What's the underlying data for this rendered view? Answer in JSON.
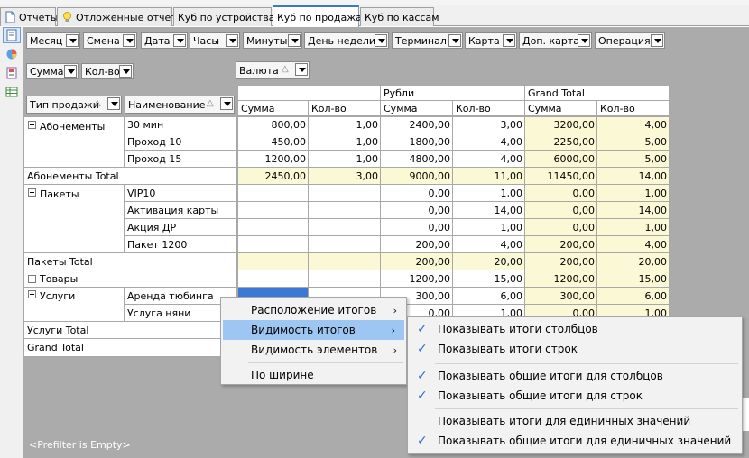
{
  "tabs": [
    {
      "label": "Отчеты",
      "icon": "document-icon"
    },
    {
      "label": "Отложенные отчеты",
      "icon": "lightbulb-icon"
    },
    {
      "label": "Куб по устройствам",
      "icon": ""
    },
    {
      "label": "Куб по продажам",
      "icon": "",
      "active": true
    },
    {
      "label": "Куб по кассам",
      "icon": ""
    }
  ],
  "sidebar": [
    "grid-view-icon",
    "chart-icon",
    "report-icon",
    "table-icon"
  ],
  "filter_fields": [
    "Месяц",
    "Смена",
    "Дата",
    "Часы",
    "Минуты",
    "День недели",
    "Терминал",
    "Карта",
    "Доп. карта",
    "Операция"
  ],
  "data_fields": [
    "Сумма",
    "Кол-во"
  ],
  "column_field": "Валюта",
  "row_fields": [
    "Тип продажи",
    "Наименование"
  ],
  "column_headers": {
    "groups": [
      "",
      "Рубли",
      "Grand Total"
    ],
    "measures": [
      "Сумма",
      "Кол-во",
      "Сумма",
      "Кол-во",
      "Сумма",
      "Кол-во"
    ]
  },
  "rows": [
    {
      "group": "Абонементы",
      "item": "30 мин",
      "values": [
        "800,00",
        "1,00",
        "2400,00",
        "3,00",
        "3200,00",
        "4,00"
      ]
    },
    {
      "group": "",
      "item": "Проход 10",
      "values": [
        "450,00",
        "1,00",
        "1800,00",
        "4,00",
        "2250,00",
        "5,00"
      ]
    },
    {
      "group": "",
      "item": "Проход 15",
      "values": [
        "1200,00",
        "1,00",
        "4800,00",
        "4,00",
        "6000,00",
        "5,00"
      ]
    },
    {
      "total": "Абонементы Total",
      "values": [
        "2450,00",
        "3,00",
        "9000,00",
        "11,00",
        "11450,00",
        "14,00"
      ]
    },
    {
      "group": "Пакеты",
      "item": "VIP10",
      "values": [
        "",
        "",
        "0,00",
        "1,00",
        "0,00",
        "1,00"
      ]
    },
    {
      "group": "",
      "item": "Активация карты",
      "values": [
        "",
        "",
        "0,00",
        "14,00",
        "0,00",
        "14,00"
      ]
    },
    {
      "group": "",
      "item": "Акция ДР",
      "values": [
        "",
        "",
        "0,00",
        "1,00",
        "0,00",
        "1,00"
      ]
    },
    {
      "group": "",
      "item": "Пакет 1200",
      "values": [
        "",
        "",
        "200,00",
        "4,00",
        "200,00",
        "4,00"
      ]
    },
    {
      "total": "Пакеты Total",
      "values": [
        "",
        "",
        "200,00",
        "20,00",
        "200,00",
        "20,00"
      ]
    },
    {
      "group": "Товары",
      "collapsed": true,
      "values": [
        "",
        "",
        "1200,00",
        "15,00",
        "1200,00",
        "15,00"
      ]
    },
    {
      "group": "Услуги",
      "item": "Аренда тюбинга",
      "values": [
        "",
        "",
        "300,00",
        "6,00",
        "300,00",
        "6,00"
      ]
    },
    {
      "group": "",
      "item": "Услуга няни",
      "values": [
        "",
        "",
        "0,00",
        "1,00",
        "0,00",
        "1,00"
      ]
    },
    {
      "total": "Услуги Total",
      "values": [
        "",
        "",
        "",
        "",
        "",
        ""
      ]
    },
    {
      "total": "Grand Total",
      "values": [
        "",
        "",
        "",
        "",
        "",
        ""
      ]
    }
  ],
  "prefilter": "<Prefilter is Empty>",
  "context_menu": {
    "items": [
      "Расположение итогов",
      "Видимость итогов",
      "Видимость элементов",
      "По ширине"
    ]
  },
  "submenu": {
    "items": [
      {
        "label": "Показывать итоги столбцов",
        "checked": true
      },
      {
        "label": "Показывать итоги строк",
        "checked": true
      },
      {
        "label": "Показывать общие итоги для столбцов",
        "checked": true
      },
      {
        "label": "Показывать общие итоги для строк",
        "checked": true
      },
      {
        "label": "Показывать итоги для единичных значений",
        "checked": false
      },
      {
        "label": "Показывать общие итоги для единичных значений",
        "checked": true
      }
    ]
  },
  "colors": {
    "accent": "#3a79d6",
    "total_bg": "#fbf8d6",
    "menu_highlight": "#9ec6f2"
  }
}
